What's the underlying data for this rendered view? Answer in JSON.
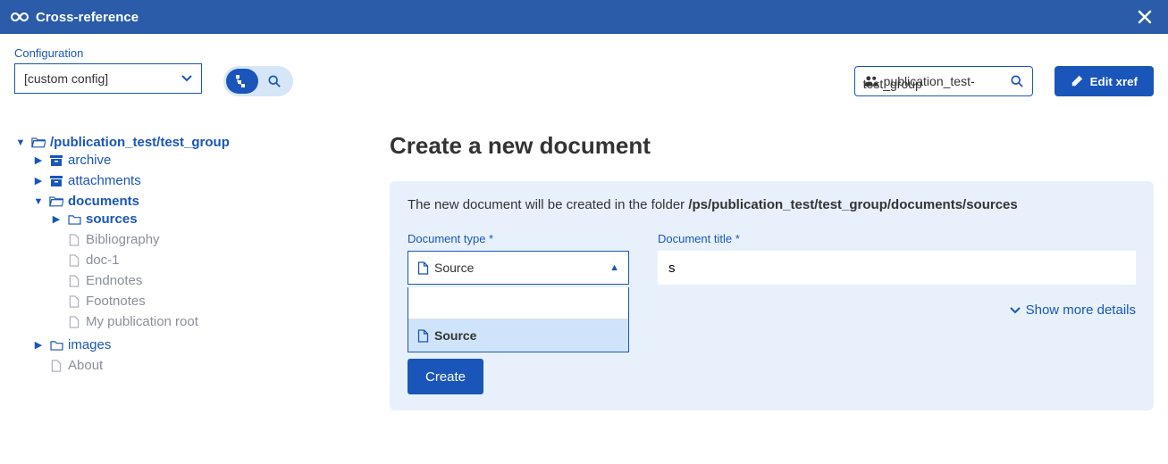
{
  "titlebar": {
    "title": "Cross-reference"
  },
  "toolbar": {
    "config_label": "Configuration",
    "config_value": "[custom config]",
    "group_value": "publication_test-",
    "group_overflow": "test_group",
    "edit_label": "Edit xref"
  },
  "tree": {
    "root": "/publication_test/test_group",
    "archive": "archive",
    "attachments": "attachments",
    "documents": "documents",
    "sources": "sources",
    "docs": [
      "Bibliography",
      "doc-1",
      "Endnotes",
      "Footnotes",
      "My publication root"
    ],
    "images": "images",
    "about": "About"
  },
  "panel": {
    "heading": "Create a new document",
    "intro_prefix": "The new document will be created in the folder ",
    "intro_path": "/ps/publication_test/test_group/documents/sources",
    "type_label": "Document type *",
    "type_value": "Source",
    "type_option": "Source",
    "title_label": "Document title *",
    "title_value": "s",
    "show_more": "Show more details",
    "create_label": "Create"
  }
}
